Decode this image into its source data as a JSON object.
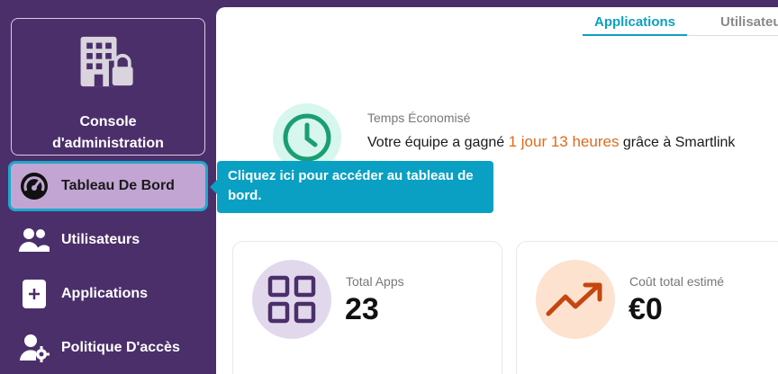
{
  "sidebar": {
    "console_label_line1": "Console",
    "console_label_line2": "d'administration",
    "items": [
      {
        "label": "Tableau De Bord",
        "icon": "dashboard-gauge-icon"
      },
      {
        "label": "Utilisateurs",
        "icon": "users-icon"
      },
      {
        "label": "Applications",
        "icon": "plus-icon"
      },
      {
        "label": "Politique D'accès",
        "icon": "user-gear-icon"
      }
    ]
  },
  "tabs": [
    {
      "label": "Applications"
    },
    {
      "label": "Utilisateurs"
    }
  ],
  "time_saved": {
    "title": "Temps Économisé",
    "text_before": "Votre équipe a gagné ",
    "highlight": "1 jour 13 heures",
    "text_after": " grâce à Smartlink"
  },
  "cards": {
    "total_apps": {
      "label": "Total Apps",
      "value": "23"
    },
    "total_cost": {
      "label": "Coût total estimé",
      "value": "€0"
    }
  },
  "tooltip": {
    "text": "Cliquez ici pour accéder au tableau de bord."
  },
  "colors": {
    "sidebar_bg": "#4b2f6a",
    "accent": "#0aa0c3",
    "highlight": "#e06a1c",
    "active_item_bg": "#c2a5d3"
  }
}
